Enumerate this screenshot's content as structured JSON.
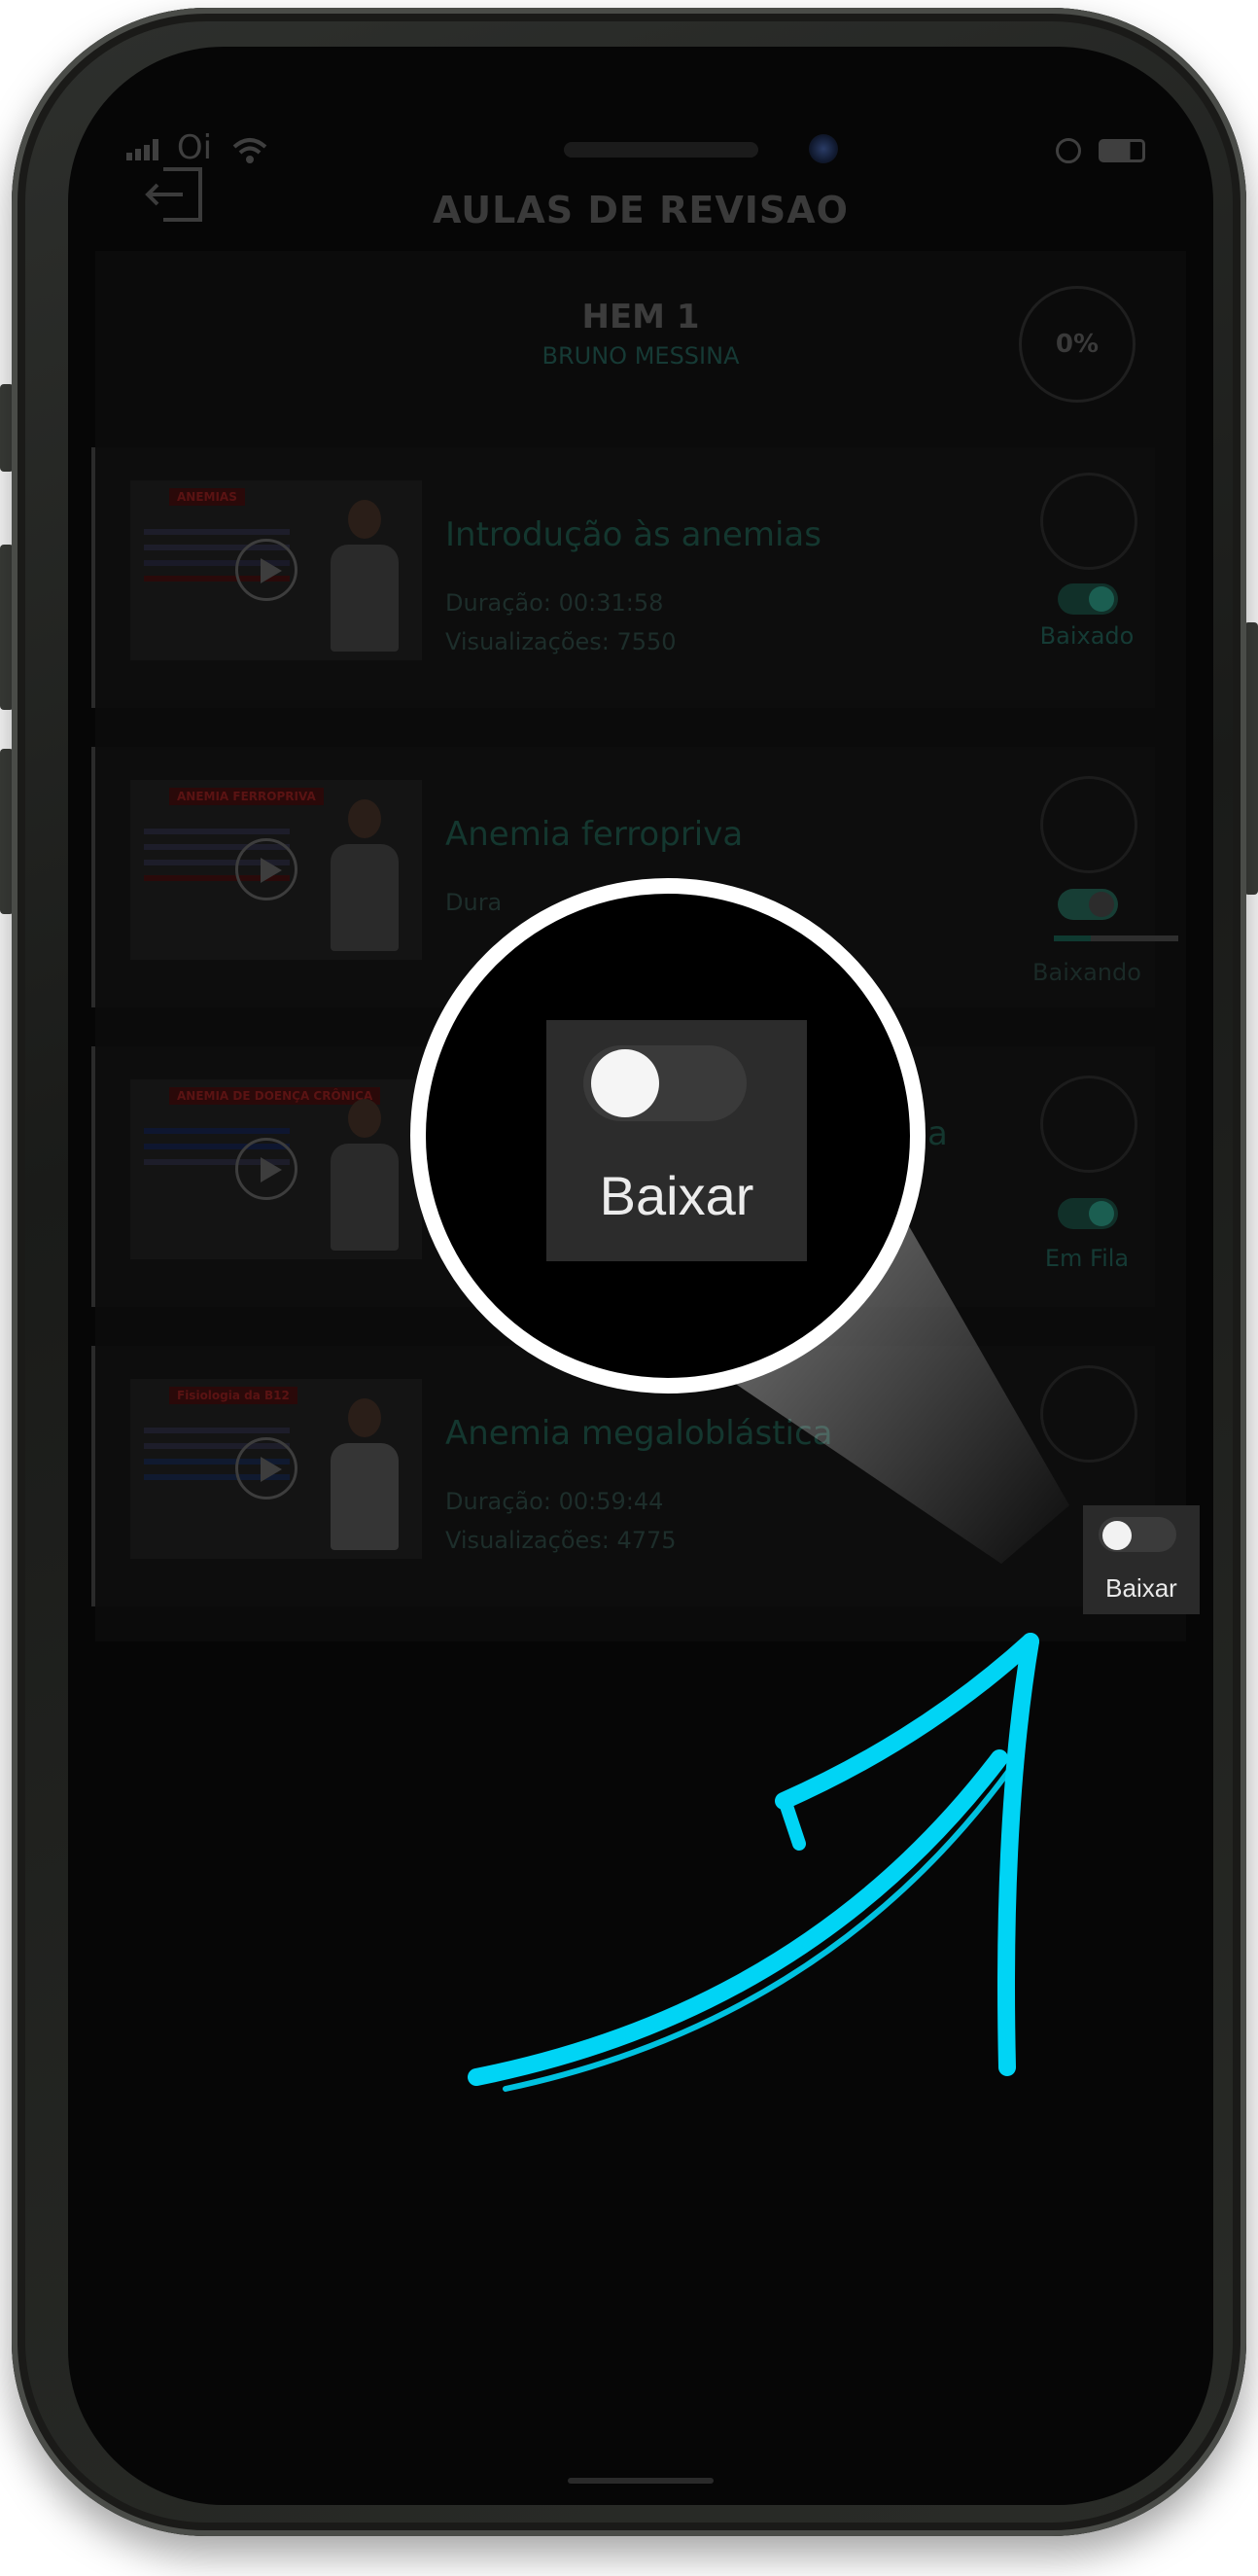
{
  "status_bar": {
    "carrier": "Oi"
  },
  "header": {
    "title": "AULAS DE REVISAO"
  },
  "course": {
    "title": "HEM 1",
    "author": "BRUNO MESSINA",
    "progress": "0%"
  },
  "lessons": [
    {
      "title": "Introdução às anemias",
      "duration": "Duração: 00:31:58",
      "views": "Visualizações: 7550",
      "download_state": "Baixado",
      "thumb_label": "ANEMIAS"
    },
    {
      "title": "Anemia ferropriva",
      "duration": "Dura",
      "download_state": "Baixando",
      "download_progress": 0.3,
      "thumb_label": "ANEMIA FERROPRIVA"
    },
    {
      "title": "a",
      "download_state": "Em Fila",
      "thumb_label": "ANEMIA DE DOENÇA CRÔNICA"
    },
    {
      "title": "Anemia megaloblástica",
      "duration": "Duração: 00:59:44",
      "views": "Visualizações: 4775",
      "download_state": "Baixar",
      "thumb_label": "Fisiologia da B12"
    }
  ],
  "highlight": {
    "label": "Baixar"
  },
  "colors": {
    "accent_arrow": "#00d4f5",
    "frame": "#1c1d1b",
    "teal_dim": "#14372f"
  }
}
